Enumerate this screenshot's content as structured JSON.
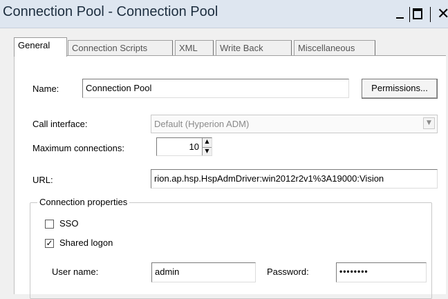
{
  "window": {
    "title": "Connection Pool - Connection Pool",
    "minimize_icon": "minimize-icon",
    "maximize_icon": "maximize-icon",
    "close_glyph": "✕"
  },
  "tabs": [
    {
      "label": "General",
      "active": true
    },
    {
      "label": "Connection Scripts",
      "active": false
    },
    {
      "label": "XML",
      "active": false
    },
    {
      "label": "Write Back",
      "active": false
    },
    {
      "label": "Miscellaneous",
      "active": false
    }
  ],
  "general": {
    "name_label": "Name:",
    "name_value": "Connection Pool",
    "permissions_button": "Permissions...",
    "call_interface_label": "Call interface:",
    "call_interface_value": "Default (Hyperion ADM)",
    "max_connections_label": "Maximum connections:",
    "max_connections_value": "10",
    "url_label": "URL:",
    "url_value": "rion.ap.hsp.HspAdmDriver:win2012r2v1%3A19000:Vision"
  },
  "connection_properties": {
    "title": "Connection properties",
    "sso_label": "SSO",
    "sso_checked": false,
    "shared_logon_label": "Shared logon",
    "shared_logon_checked": true,
    "check_glyph": "✓",
    "user_name_label": "User name:",
    "user_name_value": "admin",
    "password_label": "Password:",
    "password_value": "••••••••"
  }
}
